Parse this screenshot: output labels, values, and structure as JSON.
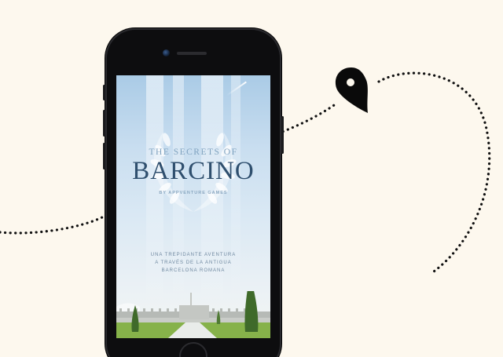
{
  "game": {
    "title_small": "THE SECRETS OF",
    "title_big": "BARCINO",
    "byline": "BY APPVENTURE GAMES",
    "tagline": [
      "UNA TREPIDANTE AVENTURA",
      "A TRAVÉS DE LA ANTIGUA",
      "BARCELONA ROMANA"
    ]
  },
  "icons": {
    "map_pin": "map-pin-icon",
    "laurel": "laurel-wreath-icon"
  },
  "colors": {
    "background": "#fdf8ee",
    "phone_body": "#0d0d0f",
    "title": "#2f4f6e",
    "sky_top": "#aacbe6",
    "grass": "#86b24a",
    "cypress": "#3f6a2a"
  }
}
